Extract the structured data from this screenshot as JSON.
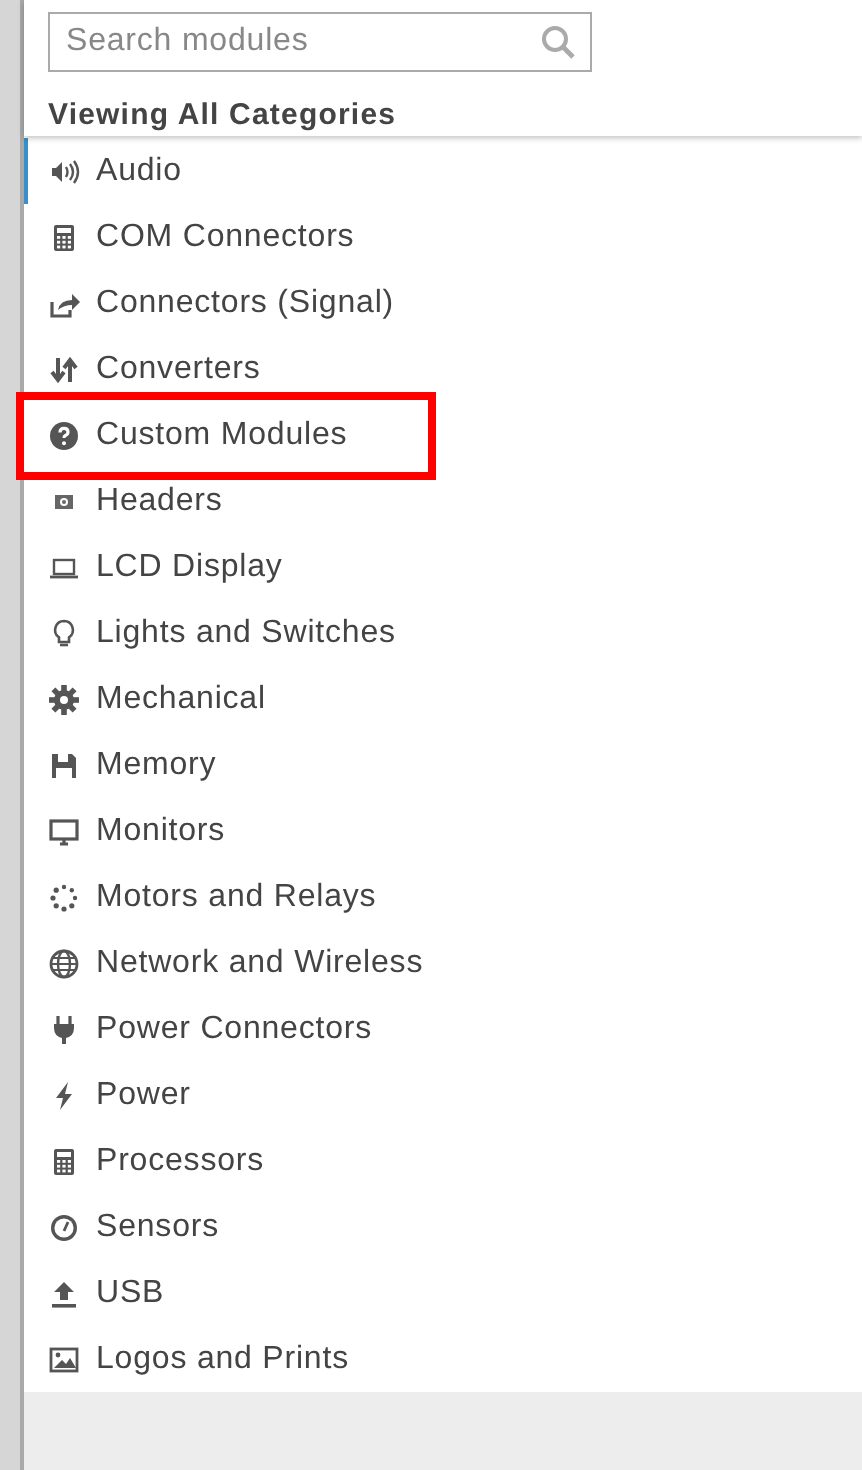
{
  "search": {
    "placeholder": "Search modules"
  },
  "heading": "Viewing All Categories",
  "categories": [
    {
      "label": "Audio",
      "selected": true,
      "highlighted": false
    },
    {
      "label": "COM Connectors",
      "selected": false,
      "highlighted": false
    },
    {
      "label": "Connectors (Signal)",
      "selected": false,
      "highlighted": false
    },
    {
      "label": "Converters",
      "selected": false,
      "highlighted": false
    },
    {
      "label": "Custom Modules",
      "selected": false,
      "highlighted": true
    },
    {
      "label": "Headers",
      "selected": false,
      "highlighted": false
    },
    {
      "label": "LCD Display",
      "selected": false,
      "highlighted": false
    },
    {
      "label": "Lights and Switches",
      "selected": false,
      "highlighted": false
    },
    {
      "label": "Mechanical",
      "selected": false,
      "highlighted": false
    },
    {
      "label": "Memory",
      "selected": false,
      "highlighted": false
    },
    {
      "label": "Monitors",
      "selected": false,
      "highlighted": false
    },
    {
      "label": "Motors and Relays",
      "selected": false,
      "highlighted": false
    },
    {
      "label": "Network and Wireless",
      "selected": false,
      "highlighted": false
    },
    {
      "label": "Power Connectors",
      "selected": false,
      "highlighted": false
    },
    {
      "label": "Power",
      "selected": false,
      "highlighted": false
    },
    {
      "label": "Processors",
      "selected": false,
      "highlighted": false
    },
    {
      "label": "Sensors",
      "selected": false,
      "highlighted": false
    },
    {
      "label": "USB",
      "selected": false,
      "highlighted": false
    },
    {
      "label": "Logos and Prints",
      "selected": false,
      "highlighted": false
    }
  ]
}
